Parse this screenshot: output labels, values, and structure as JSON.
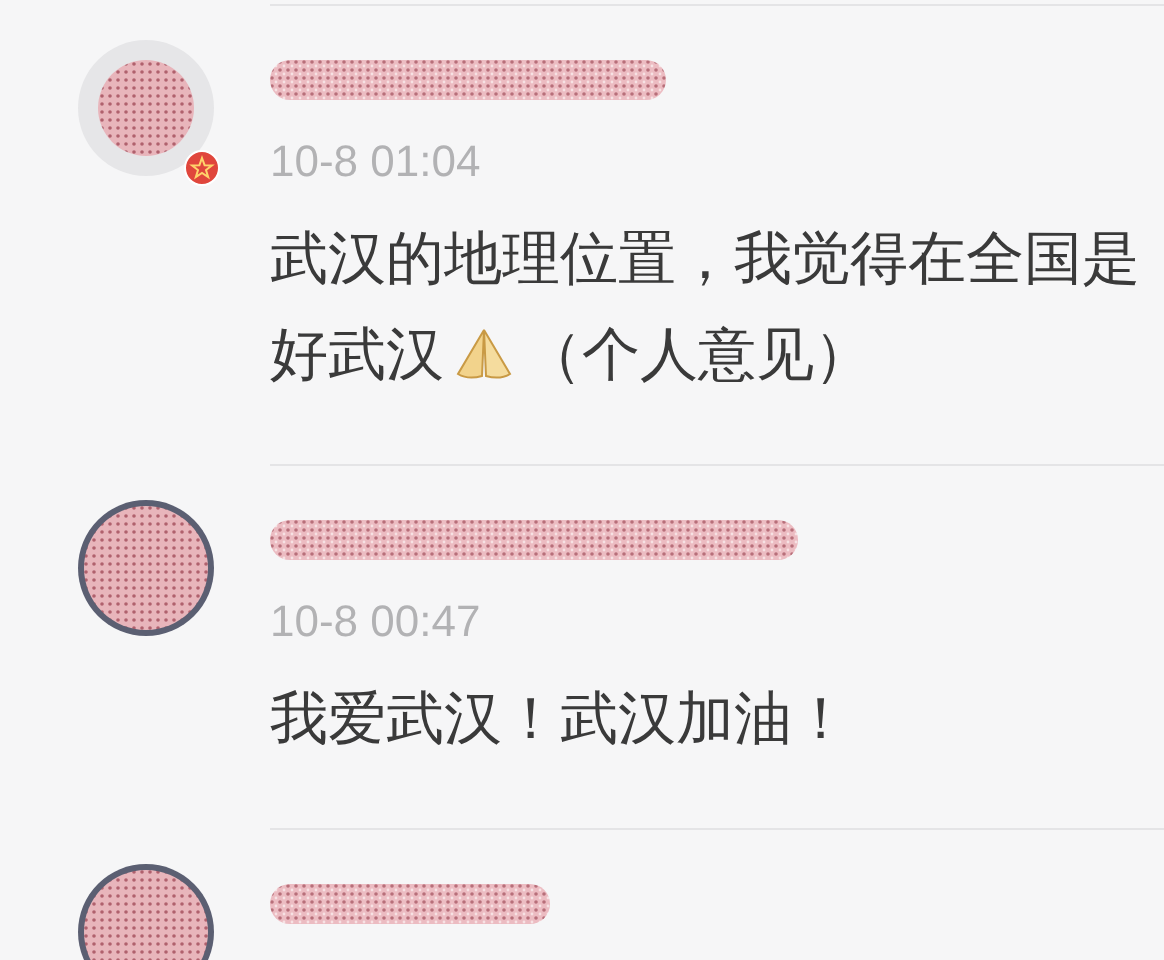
{
  "comments": [
    {
      "badge": true,
      "time": "10-8 01:04",
      "lines": [
        [
          {
            "kind": "text",
            "text": "武汉的地理位置，我觉得在全国是"
          }
        ],
        [
          {
            "kind": "text",
            "text": "好武汉"
          },
          {
            "kind": "emoji"
          },
          {
            "kind": "text",
            "text": "（个人意见）"
          }
        ]
      ]
    },
    {
      "badge": false,
      "time": "10-8 00:47",
      "lines": [
        [
          {
            "kind": "text",
            "text": "我爱武汉！武汉加油！"
          }
        ]
      ]
    },
    {
      "badge": false
    }
  ]
}
